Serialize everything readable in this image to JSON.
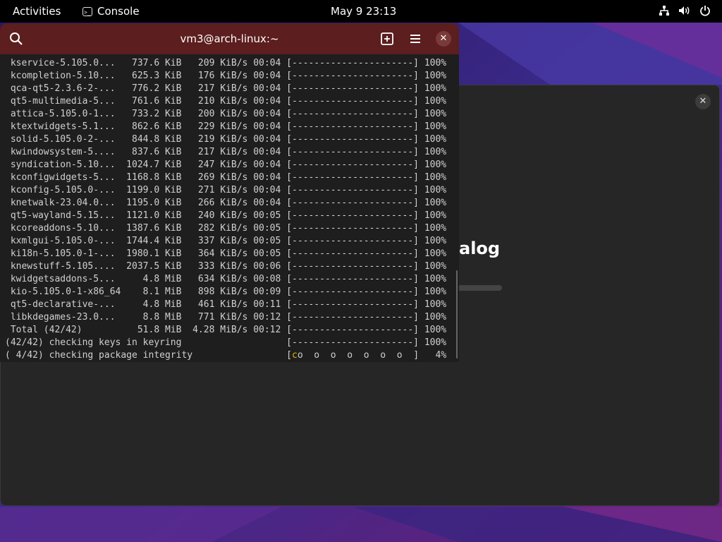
{
  "topbar": {
    "activities": "Activities",
    "app_name": "Console",
    "app_icon_glyph": ">_",
    "clock": "May 9  23:13",
    "icons": [
      "network-icon",
      "volume-icon",
      "power-icon"
    ]
  },
  "terminal": {
    "title": "vm3@arch-linux:~",
    "header_color": "#5c1e1e",
    "lines": [
      " kservice-5.105.0...   737.6 KiB   209 KiB/s 00:04 [----------------------] 100%",
      " kcompletion-5.10...   625.3 KiB   176 KiB/s 00:04 [----------------------] 100%",
      " qca-qt5-2.3.6-2-...   776.2 KiB   217 KiB/s 00:04 [----------------------] 100%",
      " qt5-multimedia-5...   761.6 KiB   210 KiB/s 00:04 [----------------------] 100%",
      " attica-5.105.0-1...   733.2 KiB   200 KiB/s 00:04 [----------------------] 100%",
      " ktextwidgets-5.1...   862.6 KiB   229 KiB/s 00:04 [----------------------] 100%",
      " solid-5.105.0-2-...   844.8 KiB   219 KiB/s 00:04 [----------------------] 100%",
      " kwindowsystem-5....   837.6 KiB   217 KiB/s 00:04 [----------------------] 100%",
      " syndication-5.10...  1024.7 KiB   247 KiB/s 00:04 [----------------------] 100%",
      " kconfigwidgets-5...  1168.8 KiB   269 KiB/s 00:04 [----------------------] 100%",
      " kconfig-5.105.0-...  1199.0 KiB   271 KiB/s 00:04 [----------------------] 100%",
      " knetwalk-23.04.0...  1195.0 KiB   266 KiB/s 00:04 [----------------------] 100%",
      " qt5-wayland-5.15...  1121.0 KiB   240 KiB/s 00:05 [----------------------] 100%",
      " kcoreaddons-5.10...  1387.6 KiB   282 KiB/s 00:05 [----------------------] 100%",
      " kxmlgui-5.105.0-...  1744.4 KiB   337 KiB/s 00:05 [----------------------] 100%",
      " ki18n-5.105.0-1-...  1980.1 KiB   364 KiB/s 00:05 [----------------------] 100%",
      " knewstuff-5.105....  2037.5 KiB   333 KiB/s 00:06 [----------------------] 100%",
      " kwidgetsaddons-5...     4.8 MiB   634 KiB/s 00:08 [----------------------] 100%",
      " kio-5.105.0-1-x86_64    8.1 MiB   898 KiB/s 00:09 [----------------------] 100%",
      " qt5-declarative-...     4.8 MiB   461 KiB/s 00:11 [----------------------] 100%",
      " libkdegames-23.0...     8.8 MiB   771 KiB/s 00:12 [----------------------] 100%",
      " Total (42/42)          51.8 MiB  4.28 MiB/s 00:12 [----------------------] 100%",
      "(42/42) checking keys in keyring                   [----------------------] 100%"
    ],
    "last_line_prefix": "( 4/42) checking package integrity                 [",
    "last_line_cursor": "c",
    "last_line_suffix": "o  o  o  o  o  o  o  ]   4%"
  },
  "dialog": {
    "title_fragment": "alog",
    "progress_fraction": 0.5
  }
}
